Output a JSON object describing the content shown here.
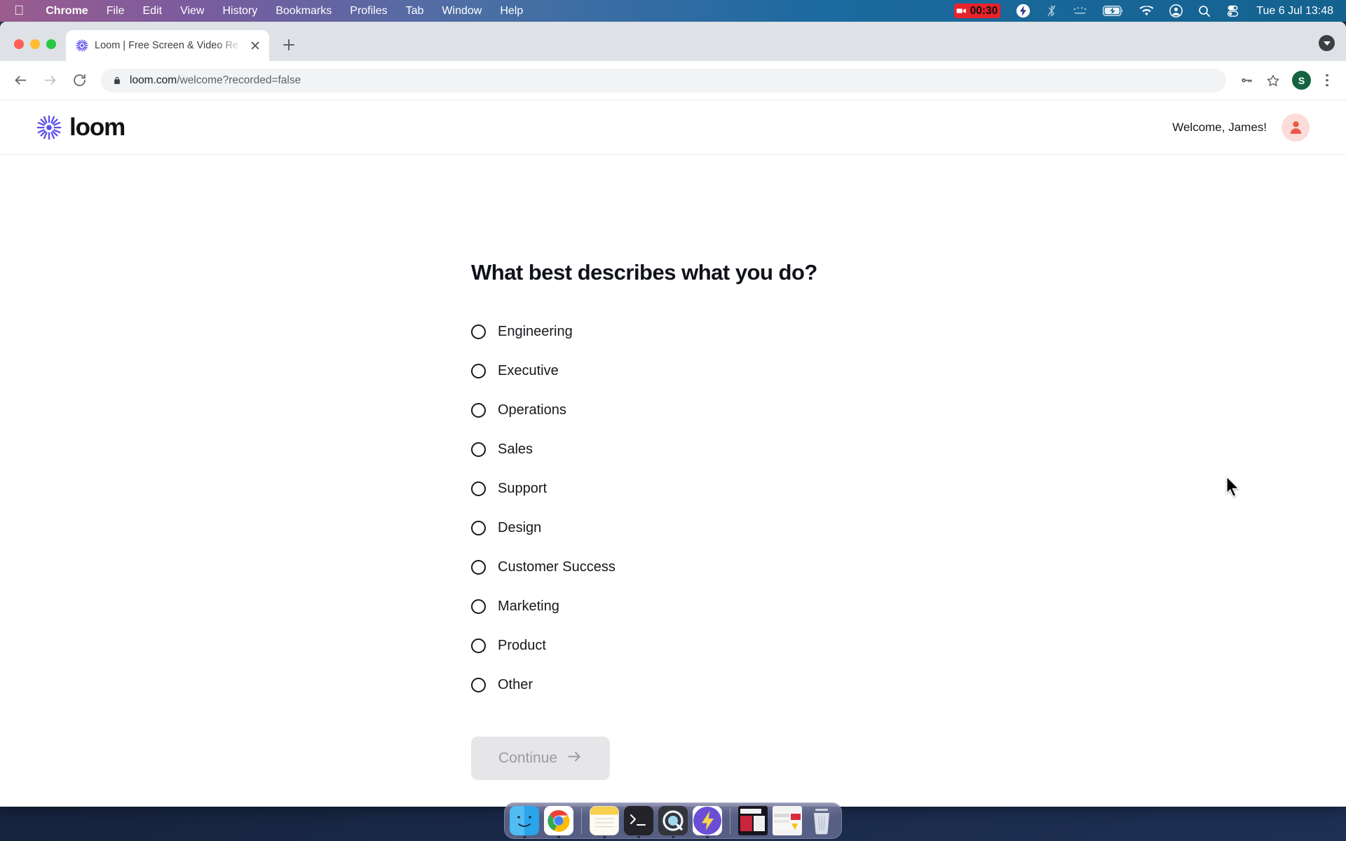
{
  "menubar": {
    "apple_icon": "apple-logo",
    "items": [
      {
        "label": "Chrome",
        "bold": true
      },
      {
        "label": "File",
        "bold": false
      },
      {
        "label": "Edit",
        "bold": false
      },
      {
        "label": "View",
        "bold": false
      },
      {
        "label": "History",
        "bold": false
      },
      {
        "label": "Bookmarks",
        "bold": false
      },
      {
        "label": "Profiles",
        "bold": false
      },
      {
        "label": "Tab",
        "bold": false
      },
      {
        "label": "Window",
        "bold": false
      },
      {
        "label": "Help",
        "bold": false
      }
    ],
    "recording_time": "00:30",
    "status_icons": [
      "screen-recording-badge",
      "loom-bolt-icon",
      "bluetooth-off-icon",
      "control-strip-icon",
      "battery-charging-icon",
      "wifi-icon",
      "account-icon",
      "spotlight-search-icon",
      "control-center-icon"
    ],
    "clock": "Tue 6 Jul  13:48"
  },
  "browser": {
    "tab": {
      "title": "Loom | Free Screen & Video Re",
      "favicon": "loom-favicon",
      "close_icon": "close-icon"
    },
    "new_tab_icon": "plus-icon",
    "downloads_icon": "download-chevron-icon",
    "toolbar": {
      "back_icon": "back-arrow-icon",
      "forward_icon": "forward-arrow-icon",
      "reload_icon": "reload-icon",
      "lock_icon": "lock-icon",
      "url_domain": "loom.com",
      "url_path": "/welcome?recorded=false",
      "password_icon": "key-icon",
      "bookmark_icon": "star-icon",
      "profile_initial": "S",
      "menu_icon": "kebab-menu-icon"
    }
  },
  "site": {
    "logo_text": "loom",
    "logo_icon": "loom-sunburst-icon",
    "welcome_text": "Welcome, James!",
    "avatar_icon": "user-avatar-icon",
    "accent_color": "#5a4ef0",
    "avatar_bg": "#fbdcd8",
    "avatar_fg": "#e8584c"
  },
  "form": {
    "question": "What best describes what you do?",
    "options": [
      {
        "label": "Engineering",
        "selected": false
      },
      {
        "label": "Executive",
        "selected": false
      },
      {
        "label": "Operations",
        "selected": false
      },
      {
        "label": "Sales",
        "selected": false
      },
      {
        "label": "Support",
        "selected": false
      },
      {
        "label": "Design",
        "selected": false
      },
      {
        "label": "Customer Success",
        "selected": false
      },
      {
        "label": "Marketing",
        "selected": false
      },
      {
        "label": "Product",
        "selected": false
      },
      {
        "label": "Other",
        "selected": false
      }
    ],
    "continue_label": "Continue",
    "continue_icon": "arrow-right-icon",
    "continue_disabled": true
  },
  "dock": {
    "items": [
      {
        "name": "finder",
        "running": true
      },
      {
        "name": "chrome",
        "running": true
      },
      {
        "name": "separator"
      },
      {
        "name": "notes",
        "running": true
      },
      {
        "name": "terminal",
        "running": true
      },
      {
        "name": "quicktime",
        "running": true
      },
      {
        "name": "loom",
        "running": true
      },
      {
        "name": "separator"
      },
      {
        "name": "screenshot-dark",
        "running": false
      },
      {
        "name": "screenshot-light",
        "running": false
      },
      {
        "name": "trash",
        "running": false
      }
    ]
  }
}
